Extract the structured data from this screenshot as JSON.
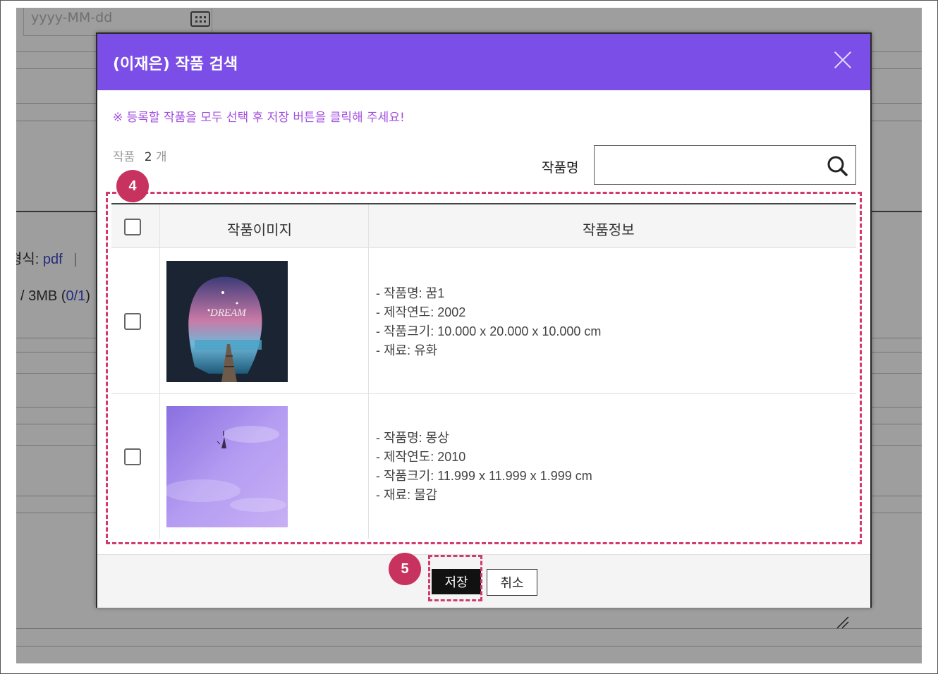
{
  "background": {
    "date_placeholder": "yyyy-MM-dd",
    "file_format_text": "형식: ",
    "file_format_value": "pdf",
    "file_separator": "|  ",
    "file_size_text": "/ 3MB (",
    "file_size_count": "0/1",
    "file_size_close": ")"
  },
  "modal": {
    "title": "(이재은) 작품 검색",
    "notice": "※ 등록할 작품을 모두 선택 후 저장 버튼을 클릭해 주세요!",
    "count_label": "작품",
    "count_value": "2",
    "count_unit": "개",
    "search_label": "작품명",
    "search_value": "",
    "table": {
      "headers": [
        "작품이미지",
        "작품정보"
      ],
      "rows": [
        {
          "image": "dream-cave-artwork",
          "info": [
            "- 작품명: 꿈1",
            "- 제작연도: 2002",
            "- 작품크기: 10.000 x 20.000 x 10.000 cm",
            "- 재료: 유화"
          ]
        },
        {
          "image": "purple-sky-artwork",
          "info": [
            "- 작품명: 몽상",
            "- 제작연도: 2010",
            "- 작품크기: 11.999 x 11.999 x 1.999 cm",
            "- 재료: 물감"
          ]
        }
      ]
    },
    "buttons": {
      "save": "저장",
      "cancel": "취소"
    }
  },
  "annotations": {
    "table_badge": "4",
    "save_badge": "5",
    "color": "#d03a6e"
  },
  "colors": {
    "header_purple": "#7b4ee8",
    "notice_purple": "#a34fe0",
    "badge": "#c8325f"
  }
}
